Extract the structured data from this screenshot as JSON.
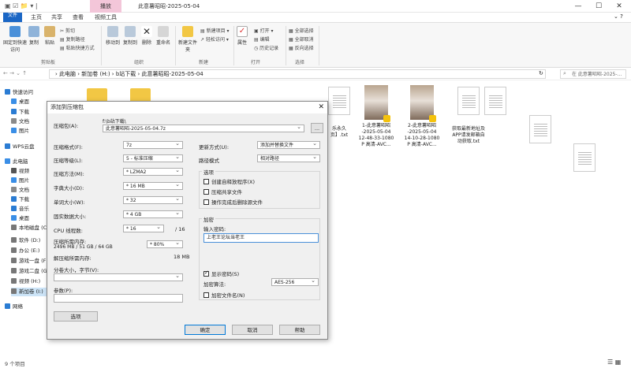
{
  "titlebar": {
    "context_tab": "播放",
    "title": "此意薯昭昭-2025-05-04",
    "minimize": "—",
    "maximize": "☐",
    "close": "✕"
  },
  "tabs": [
    "文件",
    "主页",
    "共享",
    "查看",
    "视频工具"
  ],
  "ribbon": {
    "pin": "固定到快速访问",
    "copy": "复制",
    "paste": "粘贴",
    "cut": "剪切",
    "copy_path": "复制路径",
    "paste_shortcut": "粘贴快捷方式",
    "group_clipboard": "剪贴板",
    "move_to": "移动到",
    "copy_to": "复制到",
    "delete": "删除",
    "rename": "重命名",
    "group_organize": "组织",
    "new_folder": "新建文件夹",
    "new_item": "新建项目",
    "easy_access": "轻松访问",
    "group_new": "新建",
    "properties": "属性",
    "open": "打开",
    "edit": "编辑",
    "history": "历史记录",
    "group_open": "打开",
    "select_all": "全部选择",
    "select_none": "全部取消",
    "invert": "反向选择",
    "group_select": "选择"
  },
  "address": {
    "path": "›  此电脑  ›  新加卷 (H:)  ›  b站下载  ›  此意薯昭昭-2025-05-04",
    "search_placeholder": "在 此意薯昭昭-2025-..."
  },
  "nav": [
    {
      "label": "快速访问",
      "icon": "star-icon",
      "color": "#2b7cd3"
    },
    {
      "label": "桌面",
      "icon": "desktop-icon",
      "color": "#3a8ee6"
    },
    {
      "label": "下载",
      "icon": "download-icon",
      "color": "#2b7cd3"
    },
    {
      "label": "文档",
      "icon": "document-icon",
      "color": "#8a8a8a"
    },
    {
      "label": "图片",
      "icon": "picture-icon",
      "color": "#3a8ee6"
    },
    {
      "label": "WPS云盘",
      "icon": "cloud-icon",
      "color": "#2b7cd3"
    },
    {
      "label": "此电脑",
      "icon": "computer-icon",
      "color": "#3a8ee6"
    },
    {
      "label": "视频",
      "icon": "video-icon",
      "color": "#555"
    },
    {
      "label": "图片",
      "icon": "picture-icon",
      "color": "#3a8ee6"
    },
    {
      "label": "文档",
      "icon": "document-icon",
      "color": "#8a8a8a"
    },
    {
      "label": "下载",
      "icon": "download-icon",
      "color": "#2b7cd3"
    },
    {
      "label": "音乐",
      "icon": "music-icon",
      "color": "#2b7cd3"
    },
    {
      "label": "桌面",
      "icon": "desktop-icon",
      "color": "#3a8ee6"
    },
    {
      "label": "本地磁盘 (C",
      "icon": "drive-icon",
      "color": "#777"
    },
    {
      "label": "软件 (D:)",
      "icon": "drive-icon",
      "color": "#777"
    },
    {
      "label": "办公 (E:)",
      "icon": "drive-icon",
      "color": "#777"
    },
    {
      "label": "游戏一盘 (F",
      "icon": "drive-icon",
      "color": "#777"
    },
    {
      "label": "游戏二盘 (G",
      "icon": "drive-icon",
      "color": "#777"
    },
    {
      "label": "视频 (H:)",
      "icon": "drive-icon",
      "color": "#777"
    },
    {
      "label": "新加卷 (I:)",
      "icon": "drive-icon",
      "color": "#777"
    },
    {
      "label": "网络",
      "icon": "network-icon",
      "color": "#2b7cd3"
    }
  ],
  "files": [
    {
      "name": "乐永久\n页】.txt",
      "type": "doc"
    },
    {
      "name": "1-此意薯昭昭\n-2025-05-04\n12-48-33-1080\nP 高清-AVC...",
      "type": "photo"
    },
    {
      "name": "2-此意薯昭昭\n-2025-05-04\n14-10-28-1080\nP 高清-AVC...",
      "type": "photo"
    },
    {
      "name": "获取最新地址及\nAPP请发邮箱自\n动获取.txt",
      "type": "doc"
    }
  ],
  "status": "9 个项目",
  "dialog": {
    "title": "添加到压缩包",
    "close": "✕",
    "archive_name_label": "压缩包(A):",
    "archive_folder": "f:\\b站下载\\",
    "archive_name": "此意薯昭昭-2025-05-04.7z",
    "browse": "...",
    "format_label": "压缩格式(F):",
    "format_value": "7z",
    "level_label": "压缩等级(L):",
    "level_value": "5 - 标准压缩",
    "method_label": "压缩方法(M):",
    "method_value": "* LZMA2",
    "dict_label": "字典大小(D):",
    "dict_value": "* 16 MB",
    "word_label": "单词大小(W):",
    "word_value": "* 32",
    "solid_label": "固实数据大小:",
    "solid_value": "* 4 GB",
    "threads_label": "CPU 线程数:",
    "threads_value": "* 16",
    "threads_total": "/ 16",
    "mem_label": "压缩所需内存:",
    "mem_detail": "2496 MB / 51 GB / 64 GB",
    "mem_value": "* 80%",
    "mem_unit": "",
    "decomp_label": "解压缩所需内存:",
    "decomp_value": "18 MB",
    "split_label": "分卷大小，字节(V):",
    "split_value": "",
    "params_label": "参数(P):",
    "params_value": "",
    "options_button": "选项",
    "update_label": "更新方式(U):",
    "update_value": "添加并替换文件",
    "path_label": "路径模式",
    "path_value": "相对路径",
    "options_group": "选项",
    "opt_sfx": "创建自释放程序(X)",
    "opt_shared": "压缩共享文件",
    "opt_delete": "操作完成后删除源文件",
    "encrypt_group": "加密",
    "password_label": "输入密码:",
    "password_value": "上老王论坛当老王",
    "show_password": "显示密码(S)",
    "enc_method_label": "加密算法:",
    "enc_method_value": "AES-256",
    "encrypt_names": "加密文件名(N)",
    "ok": "确定",
    "cancel": "取消",
    "help": "帮助"
  }
}
